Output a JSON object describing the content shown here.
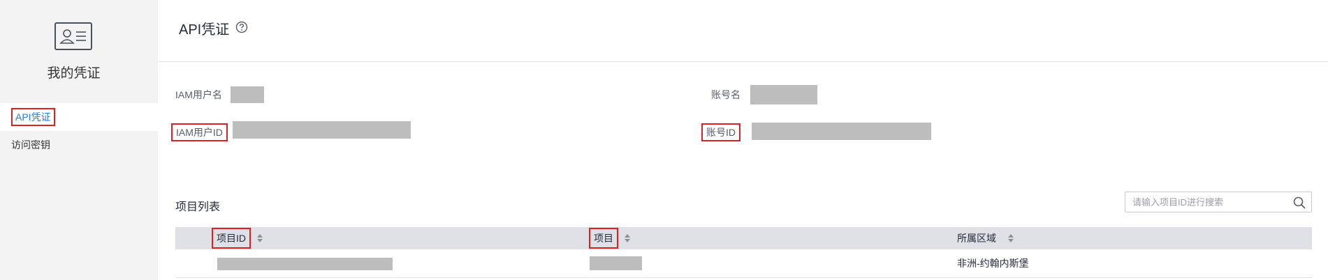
{
  "sidebar": {
    "title": "我的凭证",
    "items": [
      {
        "label": "API凭证",
        "active": true
      },
      {
        "label": "访问密钥",
        "active": false
      }
    ],
    "icon": "id-card-icon"
  },
  "header": {
    "title": "API凭证",
    "help_icon": "question-circle-icon"
  },
  "info": {
    "iam_username_label": "IAM用户名",
    "account_name_label": "账号名",
    "iam_user_id_label": "IAM用户ID",
    "account_id_label": "账号ID"
  },
  "projects": {
    "title": "项目列表",
    "search_placeholder": "请输入项目ID进行搜索",
    "columns": [
      "项目ID",
      "项目",
      "所属区域"
    ],
    "rows": [
      {
        "region": "非洲-约翰内斯堡"
      }
    ]
  },
  "colors": {
    "accent": "#1a7ef0",
    "highlight_box": "#e02020",
    "redaction": "#bdbdbd"
  }
}
